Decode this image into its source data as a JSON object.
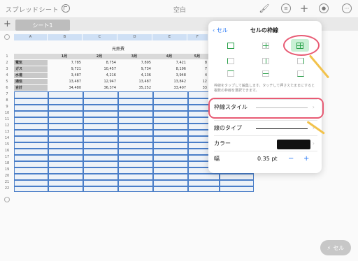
{
  "toolbar": {
    "app_title": "スプレッドシート",
    "doc_title": "空白",
    "icons": [
      "undo-icon",
      "paintbrush-icon",
      "list-icon",
      "plus-icon",
      "collaborate-icon",
      "more-icon"
    ]
  },
  "tabs": {
    "add_label": "+",
    "sheet_label": "シート1"
  },
  "sheet": {
    "columns": [
      "A",
      "B",
      "C",
      "D",
      "E",
      "F"
    ],
    "table_title": "光熱費",
    "header": [
      "",
      "1月",
      "2月",
      "3月",
      "4月",
      "5月"
    ],
    "rows": [
      [
        "電気",
        "7,785",
        "8,754",
        "7,895",
        "7,421",
        "8"
      ],
      [
        "ガス",
        "9,721",
        "10,457",
        "9,734",
        "8,196",
        "7"
      ],
      [
        "水道",
        "3,487",
        "4,216",
        "4,136",
        "3,948",
        "4"
      ],
      [
        "通信",
        "13,487",
        "12,947",
        "13,487",
        "13,842",
        "12"
      ],
      [
        "合計",
        "34,480",
        "36,374",
        "35,252",
        "33,407",
        "33"
      ]
    ],
    "row_numbers": [
      "1",
      "2",
      "3",
      "4",
      "5",
      "6",
      "7",
      "8",
      "9",
      "10",
      "11",
      "12",
      "13",
      "14",
      "15",
      "16",
      "17",
      "18",
      "19",
      "20",
      "21",
      "22"
    ]
  },
  "popover": {
    "back_label": "セル",
    "title": "セルの枠線",
    "note": "枠線をタップして編集します。タッチして押さえたままにすると複数の枠線を選択できます。",
    "border_style_label": "枠線スタイル",
    "line_type_label": "線のタイプ",
    "color_label": "カラー",
    "width_label": "幅",
    "width_value": "0.35 pt",
    "minus_label": "−",
    "plus_label": "+",
    "swatch_color": "#111111"
  },
  "cell_button": {
    "label": "セル"
  },
  "colors": {
    "accent": "#2f7cf6",
    "annotation_pink": "#e85b74",
    "annotation_yellow": "#f2c24b",
    "selection_blue": "#4a7ec8"
  }
}
